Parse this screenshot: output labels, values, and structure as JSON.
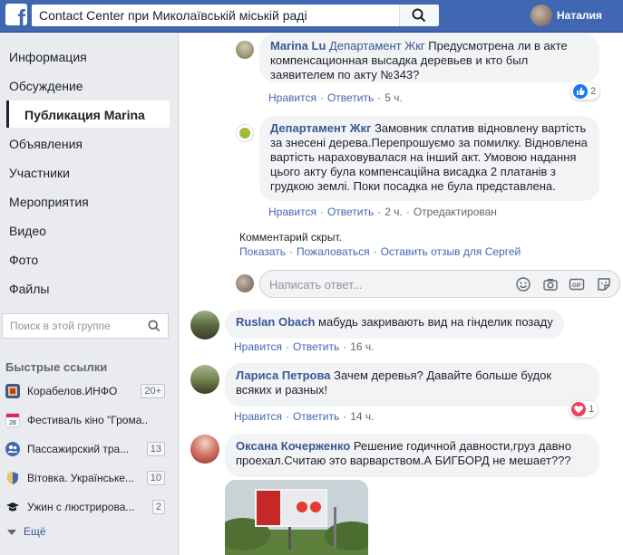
{
  "topbar": {
    "logo": "f",
    "search_value": "Contact Center при Миколаївській міській раді",
    "user_name": "Наталия"
  },
  "sidebar": {
    "nav": [
      {
        "label": "Информация"
      },
      {
        "label": "Обсуждение"
      },
      {
        "label": "Публикация Marina",
        "active": true
      },
      {
        "label": "Объявления"
      },
      {
        "label": "Участники"
      },
      {
        "label": "Мероприятия"
      },
      {
        "label": "Видео"
      },
      {
        "label": "Фото"
      },
      {
        "label": "Файлы"
      }
    ],
    "search_placeholder": "Поиск в этой группе",
    "quick_links_title": "Быстрые ссылки",
    "quick_links": [
      {
        "label": "Корабелов.ИНФО",
        "badge": "20+"
      },
      {
        "label": "Фестиваль кіно \"Грома...",
        "badge": ""
      },
      {
        "label": "Пассажирский тра...",
        "badge": "13"
      },
      {
        "label": "Вітовка. Українське...",
        "badge": "10"
      },
      {
        "label": "Ужин с люстрирова...",
        "badge": "2"
      }
    ],
    "more_label": "Ещё"
  },
  "comments": {
    "c1": {
      "author": "Marina Lu",
      "page_ref": "Департамент Жкг",
      "text": "Предусмотрена ли в акте компенсационная высадка деревьев и кто был заявителем по акту №343?",
      "like": "Нравится",
      "reply": "Ответить",
      "time": "5 ч.",
      "reaction_count": "2"
    },
    "c2": {
      "author": "Департамент Жкг",
      "text": "Замовник сплатив відновлену вартість за знесені дерева.Перепрошуємо за помилку. Відновлена вартість нараховувалася на інший акт. Умовою надання цього акту була компенсаційна висадка 2 платанів з грудкою землі. Поки посадка не була представлена.",
      "like": "Нравится",
      "reply": "Ответить",
      "time": "2 ч.",
      "edited": "Отредактирован"
    },
    "hidden": {
      "note": "Комментарий скрыт.",
      "show": "Показать",
      "report": "Пожаловаться",
      "feedback": "Оставить отзыв для Сергей"
    },
    "reply_placeholder": "Написать ответ...",
    "c3": {
      "author": "Ruslan Obach",
      "text": "мабудь закривають вид на гінделик позаду",
      "like": "Нравится",
      "reply": "Ответить",
      "time": "16 ч."
    },
    "c4": {
      "author": "Лариса Петрова",
      "text": "Зачем деревья? Давайте больше будок всяких и разных!",
      "like": "Нравится",
      "reply": "Ответить",
      "time": "14 ч.",
      "reaction_count": "1"
    },
    "c5": {
      "author": "Оксана Кочерженко",
      "text": "Решение годичной давности,груз давно проехал.Считаю это варварством.А БИГБОРД не мешает???"
    }
  },
  "colors": {
    "brand": "#4267b2",
    "link": "#385898",
    "like_blue": "#1877f2",
    "love_red": "#f33e58"
  }
}
